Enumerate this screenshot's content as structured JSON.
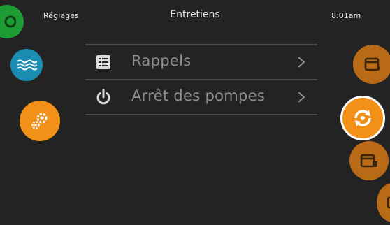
{
  "topbar": {
    "settings_label": "Réglages",
    "title": "Entretiens",
    "time": "8:01am"
  },
  "left_nav": {
    "items": [
      {
        "icon": "power-green-icon",
        "color": "#1e9c34"
      },
      {
        "icon": "water-waves-icon",
        "color": "#1a8db3"
      },
      {
        "icon": "gears-icon",
        "color": "#f29018"
      }
    ]
  },
  "right_nav": {
    "items": [
      {
        "icon": "calendar-drop-icon",
        "color": "#b86a16"
      },
      {
        "icon": "maintenance-cycle-icon",
        "color": "#f29018",
        "selected": true
      },
      {
        "icon": "calendar-clock-icon",
        "color": "#b86a16"
      },
      {
        "icon": "partial-icon",
        "color": "#b86a16"
      }
    ]
  },
  "menu": {
    "items": [
      {
        "label": "Rappels",
        "icon": "list-icon"
      },
      {
        "label": "Arrêt des pompes",
        "icon": "power-icon"
      }
    ]
  }
}
